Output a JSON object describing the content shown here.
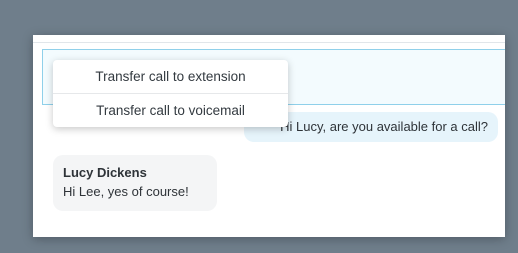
{
  "dropdown": {
    "items": [
      {
        "label": "Transfer call to extension"
      },
      {
        "label": "Transfer call to voicemail"
      }
    ]
  },
  "chat": {
    "messages": [
      {
        "direction": "outgoing",
        "text": "Hi Lucy, are you available for a call?"
      },
      {
        "direction": "incoming",
        "sender": "Lucy Dickens",
        "text": "Hi Lee, yes of course!"
      }
    ]
  },
  "colors": {
    "outgoing_bubble": "#e6f4fb",
    "incoming_bubble": "#f4f5f6",
    "header_border": "#8fd0ea"
  }
}
